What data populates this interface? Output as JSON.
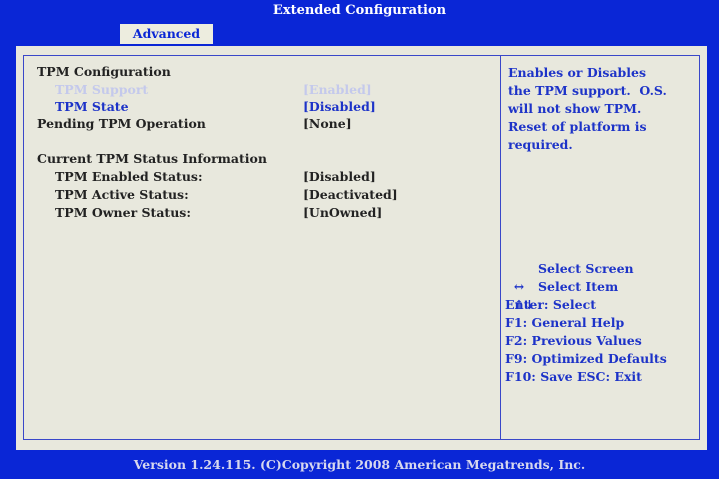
{
  "window": {
    "title": "Extended Configuration"
  },
  "tabs": [
    {
      "label": "Advanced",
      "selected": true
    }
  ],
  "settings": {
    "section_title": "TPM Configuration",
    "tpm_support": {
      "label": "TPM Support",
      "value": "[Enabled]"
    },
    "tpm_state": {
      "label": "TPM State",
      "value": "[Disabled]"
    },
    "pending_op": {
      "label": "Pending TPM Operation",
      "value": "[None]"
    },
    "status_title": "Current TPM Status Information",
    "enabled_status": {
      "label": "TPM Enabled Status:",
      "value": "[Disabled]"
    },
    "active_status": {
      "label": "TPM Active Status:",
      "value": "[Deactivated]"
    },
    "owner_status": {
      "label": "TPM Owner Status:",
      "value": "[UnOwned]"
    }
  },
  "help": {
    "lines": [
      "Enables or Disables",
      "the TPM support.  O.S.",
      "will not show TPM.",
      "Reset of platform is",
      "required."
    ],
    "keys": [
      {
        "key": "↔",
        "desc": "Select Screen"
      },
      {
        "key": "↑↓",
        "desc": "Select Item"
      },
      {
        "key": "Enter:",
        "desc": "Select"
      },
      {
        "key": "F1:",
        "desc": "General Help"
      },
      {
        "key": "F2:",
        "desc": "Previous Values"
      },
      {
        "key": "F9:",
        "desc": "Optimized Defaults"
      },
      {
        "key": "F10:",
        "desc": "Save ESC: Exit"
      }
    ]
  },
  "footer": {
    "text": "Version 1.24.115. (C)Copyright 2008 American Megatrends, Inc."
  },
  "colors": {
    "background": "#0a26d6",
    "panel": "#e8e8dd",
    "highlight_text": "#1d33c8",
    "normal_text": "#222222"
  }
}
